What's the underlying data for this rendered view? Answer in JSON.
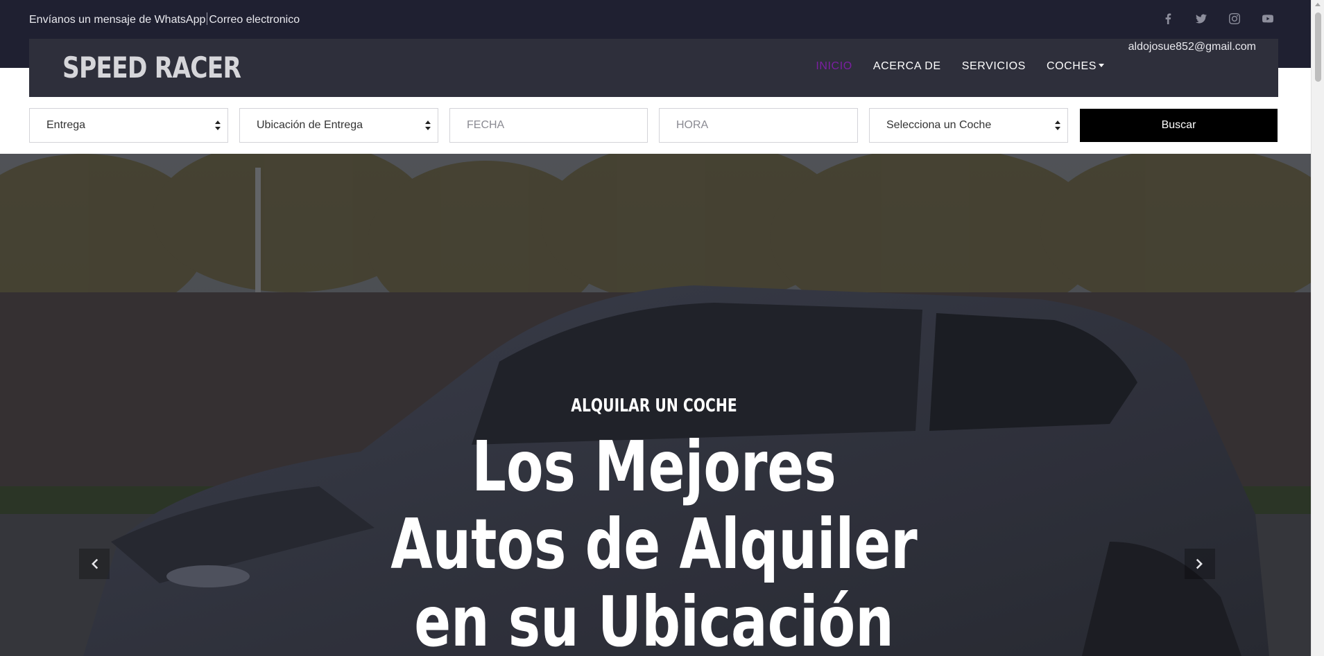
{
  "topbar": {
    "whatsapp_text": "Envíanos un mensaje de WhatsApp",
    "email_link_text": "Correo electronico",
    "social": [
      "facebook-icon",
      "twitter-icon",
      "instagram-icon",
      "youtube-icon"
    ]
  },
  "navbar": {
    "logo": "SPEED RACER",
    "email": "aldojosue852@gmail.com",
    "items": [
      "INICIO",
      "ACERCA DE",
      "SERVICIOS",
      "COCHES"
    ],
    "active_color": "#7b1fa2"
  },
  "search": {
    "pickup": "Entrega",
    "pickup_location": "Ubicación de Entrega",
    "date_placeholder": "FECHA",
    "time_placeholder": "HORA",
    "car_select": "Selecciona un Coche",
    "button": "Buscar"
  },
  "hero": {
    "kicker": "ALQUILAR UN COCHE",
    "headline": "Los Mejores Autos de Alquiler en su Ubicación"
  }
}
